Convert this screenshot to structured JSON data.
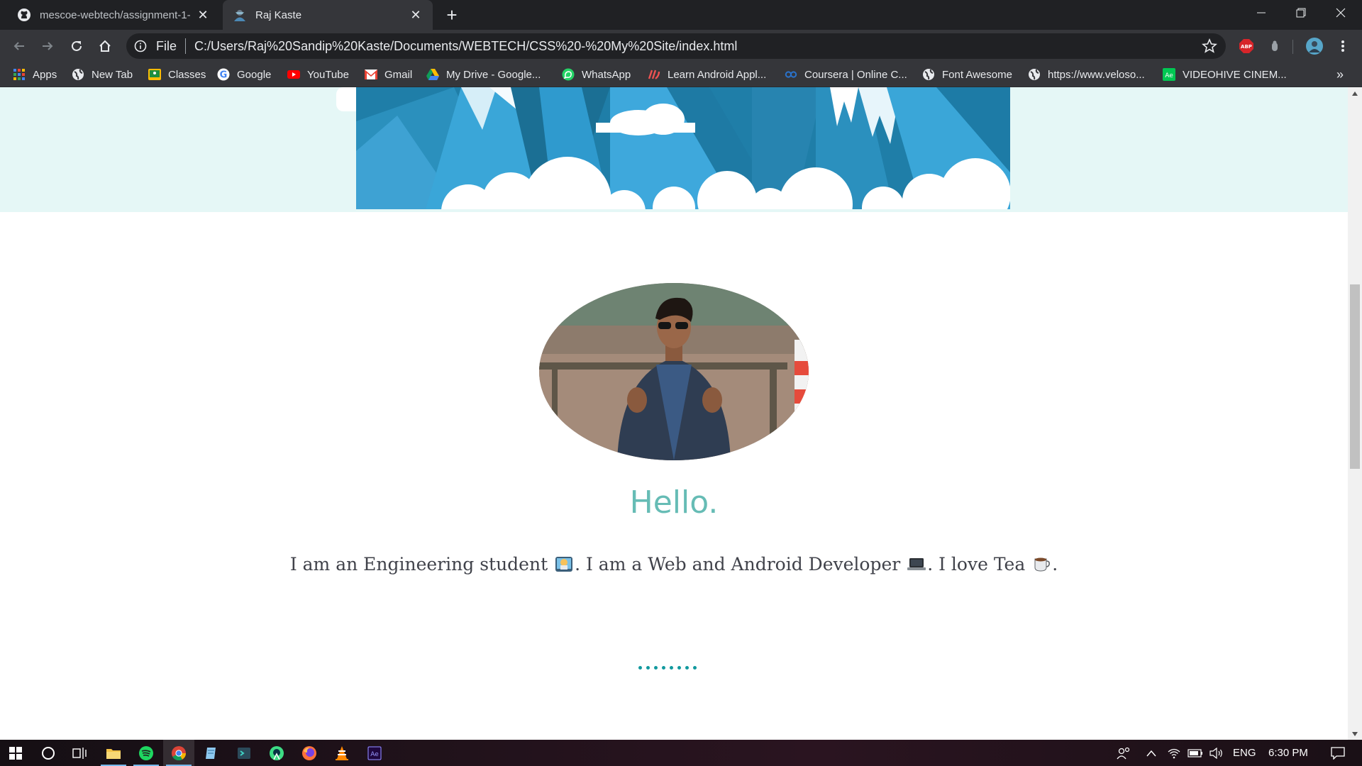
{
  "browser": {
    "tabs": [
      {
        "title": "mescoe-webtech/assignment-1-",
        "icon": "github-icon",
        "active": false
      },
      {
        "title": "Raj Kaste",
        "icon": "avatar-favicon-icon",
        "active": true
      }
    ],
    "address": {
      "scheme_label": "File",
      "url": "C:/Users/Raj%20Sandip%20Kaste/Documents/WEBTECH/CSS%20-%20My%20Site/index.html"
    },
    "extensions": {
      "abp_label": "ABP"
    },
    "bookmarks": [
      {
        "label": "Apps",
        "icon": "apps-grid-icon"
      },
      {
        "label": "New Tab",
        "icon": "globe-icon"
      },
      {
        "label": "Classes",
        "icon": "classroom-icon"
      },
      {
        "label": "Google",
        "icon": "google-icon"
      },
      {
        "label": "YouTube",
        "icon": "youtube-icon"
      },
      {
        "label": "Gmail",
        "icon": "gmail-icon"
      },
      {
        "label": "My Drive - Google...",
        "icon": "drive-icon"
      },
      {
        "label": "WhatsApp",
        "icon": "whatsapp-icon"
      },
      {
        "label": "Learn Android Appl...",
        "icon": "udemy-icon"
      },
      {
        "label": "Coursera | Online C...",
        "icon": "coursera-icon"
      },
      {
        "label": "Font Awesome",
        "icon": "globe-icon"
      },
      {
        "label": "https://www.veloso...",
        "icon": "globe-icon"
      },
      {
        "label": "VIDEOHIVE CINEM...",
        "icon": "after-effects-icon"
      }
    ],
    "overflow_label": "»"
  },
  "page": {
    "greeting": "Hello.",
    "intro": {
      "part1": "I am an Engineering student",
      "part2": ". I am a Web and Android Developer",
      "part3": ". I love Tea",
      "part4": "."
    },
    "colors": {
      "hero_bg": "#e5f7f6",
      "greeting": "#66bcb5",
      "dots": "#11999e"
    }
  },
  "taskbar": {
    "language": "ENG",
    "time": "6:30 PM",
    "ae_label": "Ae"
  }
}
